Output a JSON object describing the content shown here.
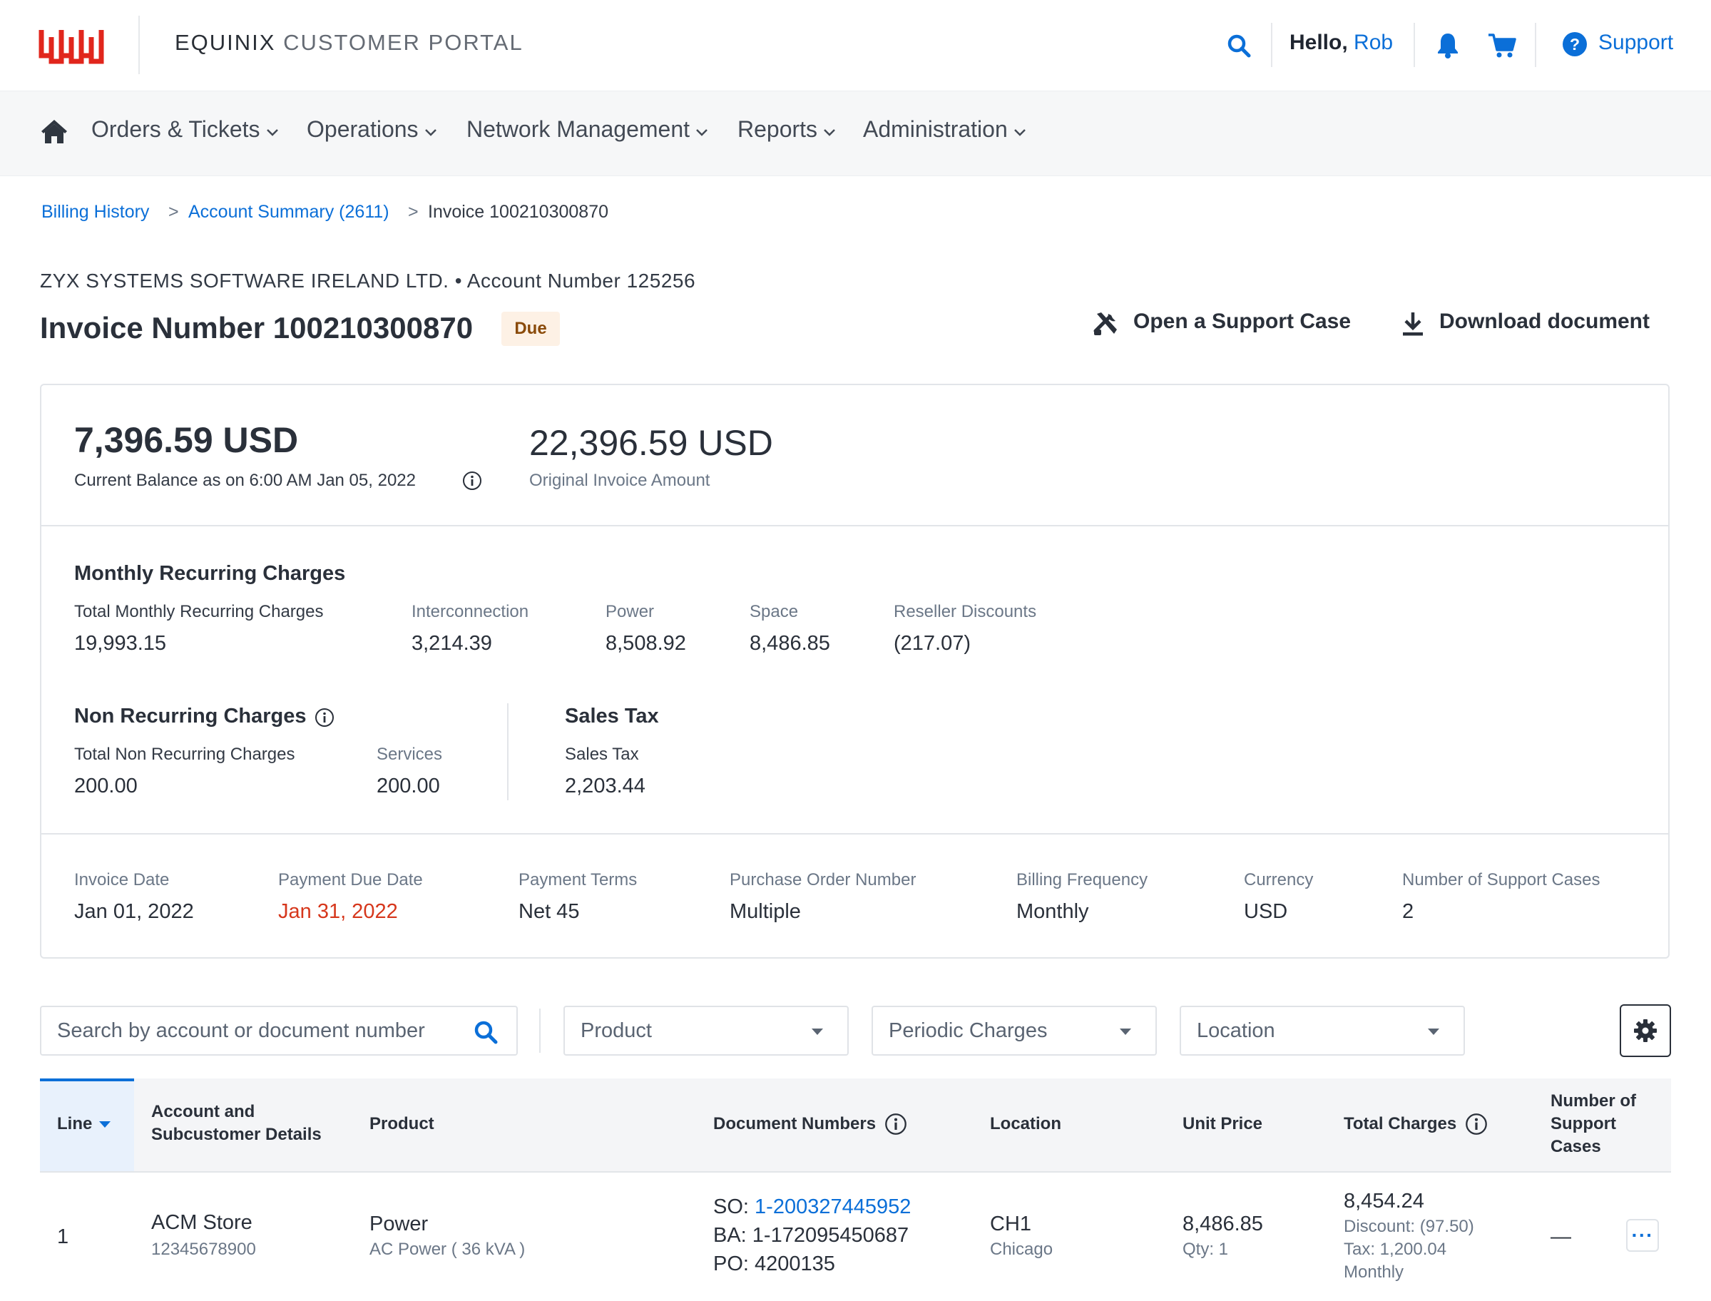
{
  "header": {
    "brand": "EQUINIX",
    "portal": "CUSTOMER PORTAL",
    "greeting": "Hello,",
    "user": "Rob",
    "support": "Support",
    "icons": [
      "search-icon",
      "bell-icon",
      "cart-icon",
      "help-icon"
    ]
  },
  "nav": {
    "items": [
      {
        "label": "Orders & Tickets"
      },
      {
        "label": "Operations"
      },
      {
        "label": "Network Management"
      },
      {
        "label": "Reports"
      },
      {
        "label": "Administration"
      }
    ]
  },
  "breadcrumb": {
    "items": [
      "Billing History",
      "Account Summary (2611)",
      "Invoice 100210300870"
    ],
    "sep": ">"
  },
  "invoice": {
    "company_line": "ZYX SYSTEMS SOFTWARE IRELAND LTD. • Account Number 125256",
    "title": "Invoice Number 100210300870",
    "status": "Due",
    "open_case": "Open a Support Case",
    "download": "Download document"
  },
  "summary": {
    "balance": "7,396.59 USD",
    "balance_label": "Current Balance as on 6:00 AM Jan 05, 2022",
    "original": "22,396.59 USD",
    "original_label": "Original Invoice Amount",
    "mrc": {
      "title": "Monthly Recurring Charges",
      "items": [
        {
          "label": "Total Monthly Recurring Charges",
          "value": "19,993.15"
        },
        {
          "label": "Interconnection",
          "value": "3,214.39"
        },
        {
          "label": "Power",
          "value": "8,508.92"
        },
        {
          "label": "Space",
          "value": "8,486.85"
        },
        {
          "label": "Reseller Discounts",
          "value": "(217.07)"
        }
      ]
    },
    "nrc": {
      "title": "Non Recurring Charges",
      "items": [
        {
          "label": "Total Non Recurring Charges",
          "value": "200.00"
        },
        {
          "label": "Services",
          "value": "200.00"
        }
      ]
    },
    "tax": {
      "title": "Sales Tax",
      "items": [
        {
          "label": "Sales Tax",
          "value": "2,203.44"
        }
      ]
    },
    "details": [
      {
        "label": "Invoice Date",
        "value": "Jan 01, 2022"
      },
      {
        "label": "Payment Due Date",
        "value": "Jan 31, 2022"
      },
      {
        "label": "Payment Terms",
        "value": "Net 45"
      },
      {
        "label": "Purchase Order Number",
        "value": "Multiple"
      },
      {
        "label": "Billing Frequency",
        "value": "Monthly"
      },
      {
        "label": "Currency",
        "value": "USD"
      },
      {
        "label": "Number of Support Cases",
        "value": "2"
      }
    ],
    "due_color": "#d6371c"
  },
  "filters": {
    "search_placeholder": "Search by account or document number",
    "product": "Product",
    "periodic": "Periodic Charges",
    "location": "Location"
  },
  "table": {
    "headers": {
      "line": "Line",
      "account": "Account and Subcustomer Details",
      "product": "Product",
      "docs": "Document Numbers",
      "location": "Location",
      "unit_price": "Unit Price",
      "total": "Total Charges",
      "cases": "Number of Support Cases"
    },
    "rows": [
      {
        "line": "1",
        "account": "ACM Store",
        "account_no": "12345678900",
        "product": "Power",
        "product_detail": "AC Power ( 36 kVA )",
        "so_label": "SO:",
        "so": "1-200327445952",
        "ba": "BA: 1-172095450687",
        "po": "PO: 4200135",
        "location": "CH1",
        "city": "Chicago",
        "unit_price": "8,486.85",
        "qty": "Qty: 1",
        "total": "8,454.24",
        "discount": "Discount: (97.50)",
        "tax": "Tax: 1,200.04",
        "freq": "Monthly",
        "cases": "—",
        "more": "···"
      }
    ]
  },
  "colors": {
    "accent": "#0b6fd8",
    "brand": "#e1261c",
    "due": "#d6371c"
  }
}
